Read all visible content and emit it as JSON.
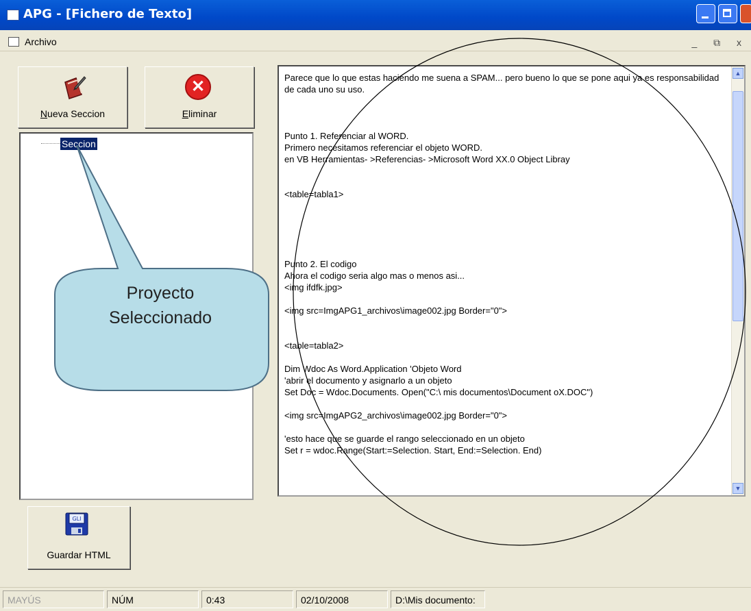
{
  "window": {
    "title": "APG - [Fichero de Texto]"
  },
  "menu": {
    "archivo_label": "Archivo",
    "mdi_controls": "_ ⧉ x"
  },
  "toolbar": {
    "new_section_label_u": "N",
    "new_section_label_rest": "ueva Seccion",
    "delete_label_u": "E",
    "delete_label_rest": "liminar",
    "save_html_label": "Guardar HTML",
    "save_icon_text": "GLI"
  },
  "tree": {
    "selected_node": "Seccion"
  },
  "callout": {
    "line1": "Proyecto",
    "line2": "Seleccionado"
  },
  "editor": {
    "content": "Parece que lo que estas haciendo me suena a SPAM... pero bueno lo que se pone aqui ya es responsabilidad de cada uno su uso.\n\n\n\nPunto 1. Referenciar al WORD.\nPrimero necesitamos referenciar el objeto WORD.\nen VB Herramientas- >Referencias- >Microsoft Word XX.0 Object Libray\n\n\n<table=tabla1>\n\n\n\n\n\nPunto 2. El codigo\nAhora el codigo seria algo mas o menos asi...\n<img ifdfk.jpg>\n\n<img src=ImgAPG1_archivos\\image002.jpg Border=\"0\">\n\n\n<table=tabla2>\n\nDim Wdoc As Word.Application 'Objeto Word\n'abrir el documento y asignarlo a un objeto\nSet Doc = Wdoc.Documents. Open(\"C:\\ mis documentos\\Document oX.DOC\")\n\n<img src=ImgAPG2_archivos\\image002.jpg Border=\"0\">\n\n'esto hace que se guarde el rango seleccionado en un objeto\nSet r = wdoc.Range(Start:=Selection. Start, End:=Selection. End)"
  },
  "status": {
    "mayus": "MAYÚS",
    "num": "NÚM",
    "time": "0:43",
    "date": "02/10/2008",
    "path": "D:\\Mis documento:"
  },
  "colors": {
    "titlebar": "#0a5fd8",
    "selection": "#0a246a",
    "callout_fill": "#b7dde8"
  }
}
